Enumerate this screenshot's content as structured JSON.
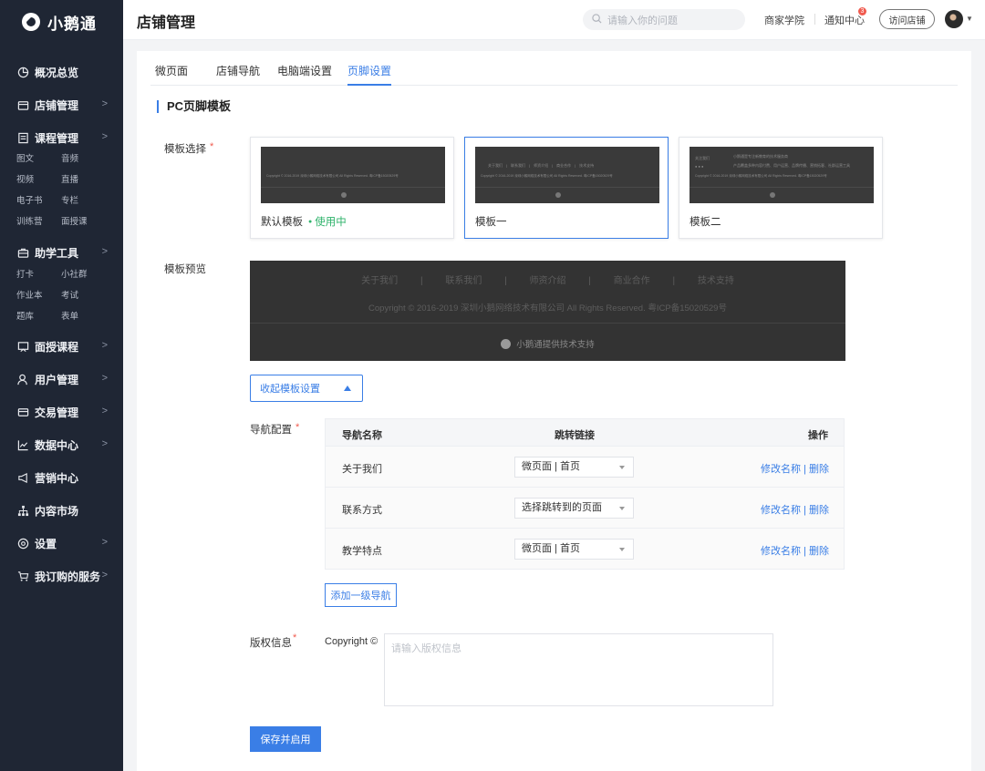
{
  "app": {
    "name": "小鹅通"
  },
  "sidebar": {
    "items": [
      {
        "label": "概况总览",
        "icon": "pie-chart-icon",
        "has_children": false
      },
      {
        "label": "店铺管理",
        "icon": "store-icon",
        "has_children": true
      },
      {
        "label": "课程管理",
        "icon": "book-icon",
        "has_children": true,
        "subitems": [
          [
            "图文",
            "音频"
          ],
          [
            "视频",
            "直播"
          ],
          [
            "电子书",
            "专栏"
          ],
          [
            "训练营",
            "面授课"
          ]
        ]
      },
      {
        "label": "助学工具",
        "icon": "briefcase-icon",
        "has_children": true,
        "subitems": [
          [
            "打卡",
            "小社群"
          ],
          [
            "作业本",
            "考试"
          ],
          [
            "题库",
            "表单"
          ]
        ]
      },
      {
        "label": "面授课程",
        "icon": "classroom-icon",
        "has_children": true
      },
      {
        "label": "用户管理",
        "icon": "user-icon",
        "has_children": true
      },
      {
        "label": "交易管理",
        "icon": "card-icon",
        "has_children": true
      },
      {
        "label": "数据中心",
        "icon": "line-chart-icon",
        "has_children": true
      },
      {
        "label": "营销中心",
        "icon": "megaphone-icon",
        "has_children": false
      },
      {
        "label": "内容市场",
        "icon": "hierarchy-icon",
        "has_children": false
      },
      {
        "label": "设置",
        "icon": "settings-icon",
        "has_children": true
      },
      {
        "label": "我订购的服务",
        "icon": "cart-icon",
        "has_children": true
      }
    ]
  },
  "header": {
    "title": "店铺管理",
    "search_placeholder": "请输入你的问题",
    "links": {
      "academy": "商家学院",
      "notifications": "通知中心"
    },
    "notification_count": "3",
    "visit_store": "访问店铺"
  },
  "tabs": [
    {
      "label": "微页面",
      "active": false
    },
    {
      "label": "店铺导航",
      "active": false
    },
    {
      "label": "电脑端设置",
      "active": false
    },
    {
      "label": "页脚设置",
      "active": true
    }
  ],
  "section_title": "PC页脚模板",
  "template_select": {
    "label": "模板选择",
    "templates": [
      {
        "name": "默认模板",
        "status": "使用中",
        "selected": false
      },
      {
        "name": "模板一",
        "status": "",
        "selected": true
      },
      {
        "name": "模板二",
        "status": "",
        "selected": false
      }
    ]
  },
  "preview": {
    "label": "模板预览",
    "links": [
      "关于我们",
      "|",
      "联系我们",
      "|",
      "师资介绍",
      "|",
      "商业合作",
      "|",
      "技术支持"
    ],
    "copyright": "Copyright © 2016-2019 深圳小鹅网络技术有限公司 All Rights Reserved. 粤ICP备15020529号",
    "support": "小鹅通提供技术支持"
  },
  "collapse_button": "收起模板设置",
  "nav_config": {
    "label": "导航配置",
    "columns": {
      "name": "导航名称",
      "link": "跳转链接",
      "ops": "操作"
    },
    "rows": [
      {
        "name": "关于我们",
        "link": "微页面 | 首页",
        "edit": "修改名称",
        "sep": "|",
        "delete": "删除"
      },
      {
        "name": "联系方式",
        "link": "选择跳转到的页面",
        "edit": "修改名称",
        "sep": "|",
        "delete": "删除"
      },
      {
        "name": "教学特点",
        "link": "微页面 | 首页",
        "edit": "修改名称",
        "sep": "|",
        "delete": "删除"
      }
    ],
    "add_button": "添加一级导航"
  },
  "copyright_info": {
    "label": "版权信息",
    "prefix": "Copyright ©",
    "placeholder": "请输入版权信息",
    "value": ""
  },
  "save_button": "保存并启用",
  "colors": {
    "accent": "#3a7ee6",
    "sidebar_bg": "#1f2634",
    "success": "#2fb36b",
    "danger": "#f05b4f"
  }
}
